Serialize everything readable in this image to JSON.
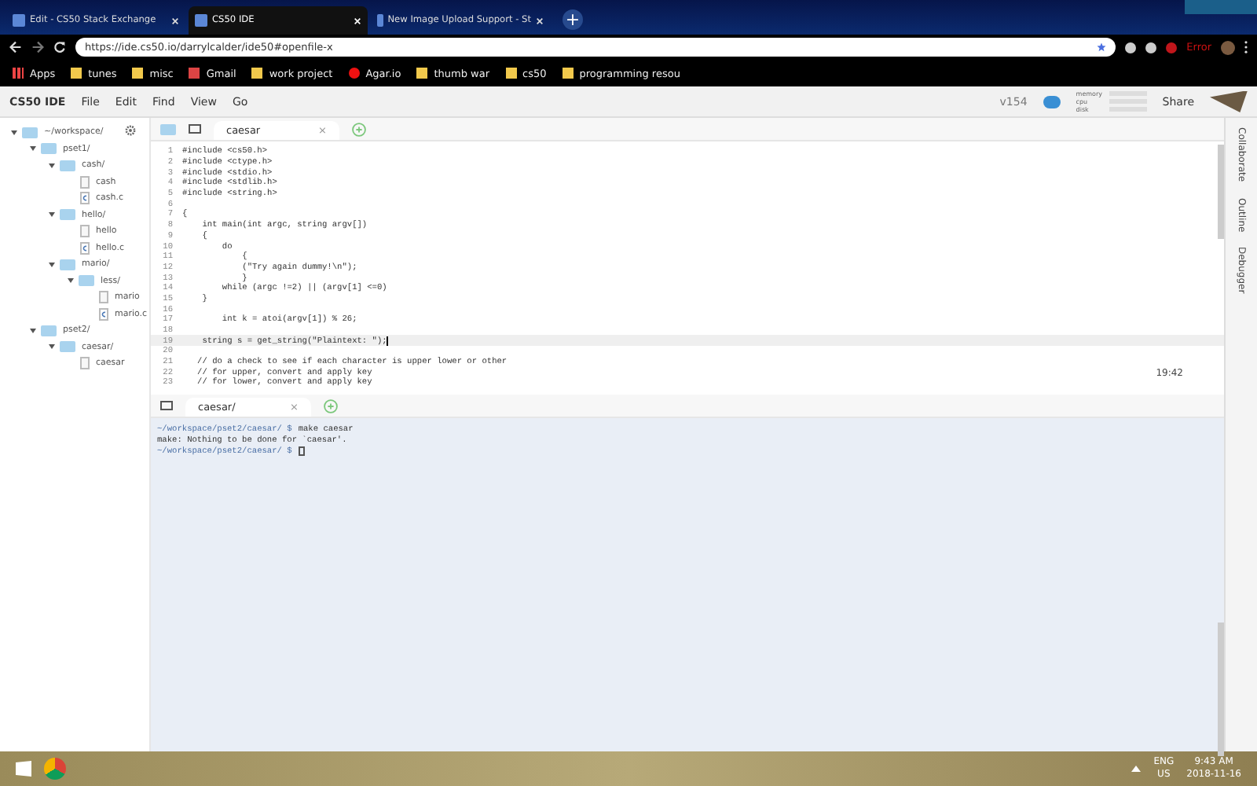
{
  "browser": {
    "tabs": [
      {
        "title": "Edit - CS50 Stack Exchange",
        "selected": false
      },
      {
        "title": "CS50 IDE",
        "selected": true
      },
      {
        "title": "New Image Upload Support - St",
        "selected": false
      }
    ],
    "new_tab": "+",
    "url": "https://ide.cs50.io/darrylcalder/ide50#openfile-x",
    "profile": "Error",
    "bookmarks": [
      {
        "label": "Apps",
        "kind": "apps"
      },
      {
        "label": "tunes",
        "kind": "folder"
      },
      {
        "label": "misc",
        "kind": "folder"
      },
      {
        "label": "Gmail",
        "kind": "mail"
      },
      {
        "label": "work project",
        "kind": "folder"
      },
      {
        "label": "Agar.io",
        "kind": "site"
      },
      {
        "label": "thumb war",
        "kind": "folder"
      },
      {
        "label": "cs50",
        "kind": "folder"
      },
      {
        "label": "programming resou",
        "kind": "folder"
      }
    ]
  },
  "ide": {
    "logo": "CS50 IDE",
    "menu": [
      "File",
      "Edit",
      "Find",
      "View",
      "Go"
    ],
    "version": "v154",
    "stats": [
      "memory",
      "cpu",
      "disk"
    ],
    "share": "Share",
    "tree": [
      {
        "name": "~/workspace/",
        "kind": "folder",
        "expanded": true,
        "children": [
          {
            "name": "pset1/",
            "kind": "folder",
            "expanded": true,
            "children": [
              {
                "name": "cash/",
                "kind": "folder",
                "expanded": true,
                "children": [
                  {
                    "name": "cash",
                    "kind": "file"
                  },
                  {
                    "name": "cash.c",
                    "kind": "c-file"
                  }
                ]
              },
              {
                "name": "hello/",
                "kind": "folder",
                "expanded": true,
                "children": [
                  {
                    "name": "hello",
                    "kind": "file"
                  },
                  {
                    "name": "hello.c",
                    "kind": "c-file"
                  }
                ]
              },
              {
                "name": "mario/",
                "kind": "folder",
                "expanded": true,
                "children": [
                  {
                    "name": "less/",
                    "kind": "folder",
                    "expanded": true,
                    "children": [
                      {
                        "name": "mario",
                        "kind": "file"
                      },
                      {
                        "name": "mario.c",
                        "kind": "c-file"
                      }
                    ]
                  }
                ]
              }
            ]
          },
          {
            "name": "pset2/",
            "kind": "folder",
            "expanded": true,
            "children": [
              {
                "name": "caesar/",
                "kind": "folder",
                "expanded": true,
                "children": [
                  {
                    "name": "caesar",
                    "kind": "file"
                  }
                ]
              }
            ]
          }
        ]
      }
    ],
    "editor_tab": "caesar",
    "editor_tab_close": "×",
    "code": [
      {
        "n": "1",
        "text": "#include <cs50.h>",
        "current": false
      },
      {
        "n": "2",
        "text": "#include <ctype.h>",
        "current": false
      },
      {
        "n": "3",
        "text": "#include <stdio.h>",
        "current": false
      },
      {
        "n": "4",
        "text": "#include <stdlib.h>",
        "current": false
      },
      {
        "n": "5",
        "text": "#include <string.h>",
        "current": false
      },
      {
        "n": "6",
        "current": false
      },
      {
        "n": "7",
        "text": "{",
        "current": false
      },
      {
        "n": "8",
        "text": "    int main(int argc, string argv[])",
        "current": false
      },
      {
        "n": "9",
        "text": "    {",
        "current": false
      },
      {
        "n": "10",
        "text": "        do",
        "current": false
      },
      {
        "n": "11",
        "text": "            {",
        "current": false
      },
      {
        "n": "12",
        "text": "            (\"Try again dummy!\\n\");",
        "current": false
      },
      {
        "n": "13",
        "text": "            }",
        "current": false
      },
      {
        "n": "14",
        "text": "        while (argc !=2) || (argv[1] <=0)",
        "current": false
      },
      {
        "n": "15",
        "text": "    }",
        "current": false
      },
      {
        "n": "16",
        "current": false
      },
      {
        "n": "17",
        "text": "        int k = atoi(argv[1]) % 26;",
        "current": false
      },
      {
        "n": "18",
        "current": false
      },
      {
        "n": "19",
        "text": "    string s = get_string(\"Plaintext: \");",
        "current": true
      },
      {
        "n": "20",
        "current": false
      },
      {
        "n": "21",
        "text": "   // do a check to see if each character is upper lower or other",
        "current": false
      },
      {
        "n": "22",
        "text": "   // for upper, convert and apply key",
        "current": false
      },
      {
        "n": "23",
        "text": "   // for lower, convert and apply key",
        "current": false
      }
    ],
    "cursor_pos": "19:42",
    "terminal_tab": "caesar/",
    "terminal_tab_close": "×",
    "terminal": [
      {
        "kind": "prompt",
        "prompt": "~/workspace/pset2/caesar/ $",
        "text": "make caesar"
      },
      {
        "kind": "output",
        "text": "make: Nothing to be done for `caesar'."
      },
      {
        "kind": "prompt",
        "prompt": "~/workspace/pset2/caesar/ $"
      }
    ],
    "side_panels": [
      "Collaborate",
      "Outline",
      "Debugger"
    ]
  },
  "taskbar": {
    "lang": "ENG",
    "region": "US",
    "time": "9:43 AM",
    "date": "2018-11-16"
  }
}
